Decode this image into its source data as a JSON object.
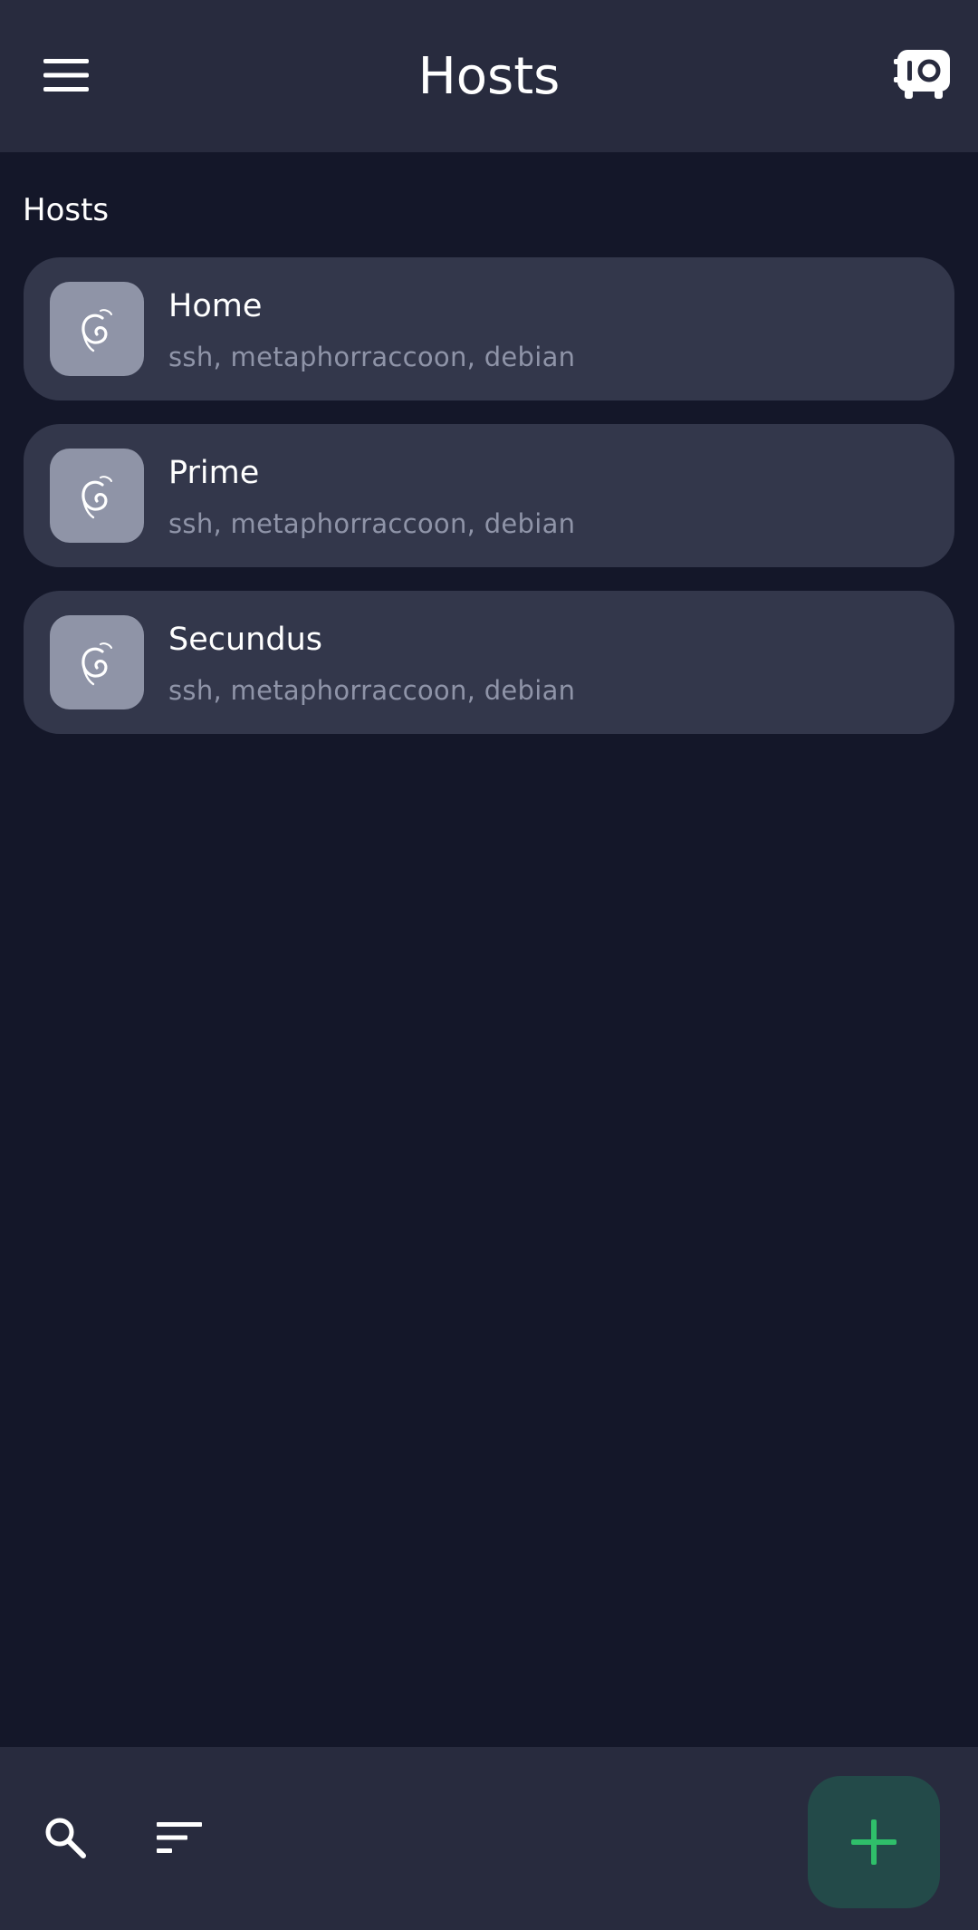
{
  "header": {
    "title": "Hosts",
    "menu_icon": "hamburger-menu-icon",
    "vault_icon": "vault-safe-icon"
  },
  "section": {
    "label": "Hosts"
  },
  "hosts": [
    {
      "name": "Home",
      "tags": "ssh, metaphorraccoon, debian",
      "icon": "debian-logo-icon"
    },
    {
      "name": "Prime",
      "tags": "ssh, metaphorraccoon, debian",
      "icon": "debian-logo-icon"
    },
    {
      "name": "Secundus",
      "tags": "ssh, metaphorraccoon, debian",
      "icon": "debian-logo-icon"
    }
  ],
  "bottom_bar": {
    "search_icon": "search-icon",
    "sort_icon": "sort-icon",
    "add_icon": "plus-icon"
  },
  "colors": {
    "background": "#141729",
    "bar": "#282b3e",
    "card": "#33374b",
    "icon_tile": "#8f94a7",
    "secondary_text": "#8f94a8",
    "fab_background": "#234a49",
    "accent_green": "#2fbf6a"
  }
}
